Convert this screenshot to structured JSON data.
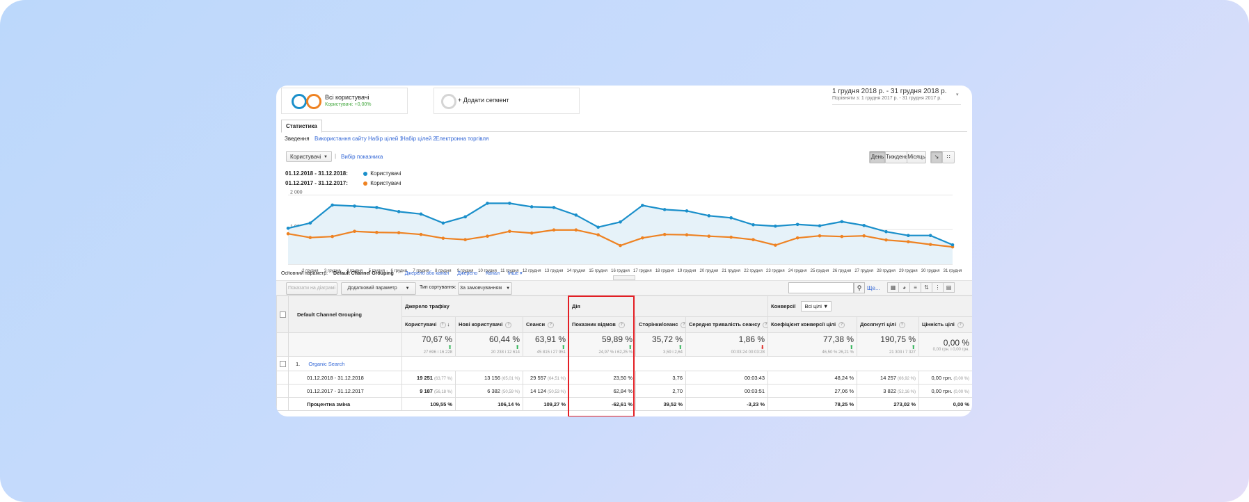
{
  "segments": {
    "all_users": {
      "title": "Всі користувачі",
      "subtitle": "Користувачі: +0,00%"
    },
    "add_segment": "+ Додати сегмент"
  },
  "date_range": {
    "current": "1 грудня 2018 р. - 31 грудня 2018 р.",
    "compare": "Порівняти з: 1 грудня 2017 р. - 31 грудня 2017 р."
  },
  "tab": "Статистика",
  "subnav": [
    "Зведення",
    "Використання сайту",
    "Набір цілей 1",
    "Набір цілей 2",
    "Електронна торгівля"
  ],
  "metric_selector": {
    "value": "Користувачі",
    "select_metric": "Вибір показника"
  },
  "period_buttons": [
    "День",
    "Тиждень",
    "Місяць"
  ],
  "colors": {
    "series_2018": "#1a8fca",
    "series_2017": "#ee8222",
    "link": "#3367d6",
    "highlight": "#e31e24"
  },
  "chart_data": {
    "type": "line",
    "x": [
      "...",
      "2 грудня",
      "3 грудня",
      "4 грудня",
      "5 грудня",
      "6 грудня",
      "7 грудня",
      "8 грудня",
      "9 грудня",
      "10 грудня",
      "11 грудня",
      "12 грудня",
      "13 грудня",
      "14 грудня",
      "15 грудня",
      "16 грудня",
      "17 грудня",
      "18 грудня",
      "19 грудня",
      "20 грудня",
      "21 грудня",
      "22 грудня",
      "23 грудня",
      "24 грудня",
      "25 грудня",
      "26 грудня",
      "27 грудня",
      "28 грудня",
      "29 грудня",
      "30 грудня",
      "31 грудня"
    ],
    "series": [
      {
        "legend_date": "01.12.2018 - 31.12.2018:",
        "name": "Користувачі",
        "values": [
          1040,
          1190,
          1710,
          1680,
          1640,
          1520,
          1450,
          1190,
          1370,
          1760,
          1760,
          1660,
          1640,
          1420,
          1070,
          1220,
          1700,
          1580,
          1540,
          1400,
          1340,
          1140,
          1100,
          1150,
          1110,
          1230,
          1120,
          940,
          830,
          830,
          560
        ]
      },
      {
        "legend_date": "01.12.2017 - 31.12.2017:",
        "name": "Користувачі",
        "values": [
          880,
          770,
          800,
          950,
          920,
          910,
          860,
          750,
          710,
          810,
          950,
          900,
          990,
          990,
          850,
          540,
          760,
          860,
          850,
          810,
          780,
          710,
          550,
          760,
          820,
          800,
          820,
          700,
          650,
          570,
          500
        ]
      }
    ],
    "y_ticks": [
      "2 000",
      "1 000"
    ],
    "ylim": [
      0,
      2150
    ]
  },
  "dimension_bar": {
    "label": "Основний параметр:",
    "current": "Default Channel Grouping",
    "options": [
      "Джерело або канал",
      "Джерело",
      "Канал",
      "Інше"
    ]
  },
  "toolbar": {
    "plot_rows": "Показати на діаграмі",
    "secondary_dim": "Додатковий параметр",
    "sort_type_label": "Тип сортування:",
    "sort_value": "За замовчуванням",
    "more": "Ще..."
  },
  "table": {
    "group_headers": {
      "acquisition": "Джерело трафіку",
      "behavior": "Дія",
      "conversions": "Конверсії",
      "goal_select": "Всі цілі"
    },
    "dim_header": "Default Channel Grouping",
    "columns": [
      "Користувачі",
      "Нові користувачі",
      "Сеанси",
      "Показник відмов",
      "Сторінки/сеанс",
      "Середня тривалість сеансу",
      "Коефіцієнт конверсії цілі",
      "Досягнуті цілі",
      "Цінність цілі"
    ],
    "totals": [
      {
        "big": "70,67 %",
        "dir": "up",
        "small": "27 696 і 16 228"
      },
      {
        "big": "60,44 %",
        "dir": "up",
        "small": "20 238 і 12 614"
      },
      {
        "big": "63,91 %",
        "dir": "up",
        "small": "45 815 і 27 951"
      },
      {
        "big": "59,89 %",
        "dir": "up",
        "small": "24,97 % і 62,25 %"
      },
      {
        "big": "35,72 %",
        "dir": "up",
        "small": "3,59 і 2,64"
      },
      {
        "big": "1,86 %",
        "dir": "down",
        "small": "00:03:24 00:03:28"
      },
      {
        "big": "77,38 %",
        "dir": "up",
        "small": "46,50 % 26,21 %"
      },
      {
        "big": "190,75 %",
        "dir": "up",
        "small": "21 303 і 7 327"
      },
      {
        "big": "0,00 %",
        "dir": "",
        "small": "0,00 грн. і 0,00 грн."
      }
    ],
    "row_index": "1.",
    "row_name": "Organic Search",
    "rows": [
      {
        "label": "01.12.2018 - 31.12.2018",
        "cells": [
          [
            "19 251",
            "(63,77 %)"
          ],
          [
            "13 156",
            "(65,01 %)"
          ],
          [
            "29 557",
            "(64,51 %)"
          ],
          [
            "23,50 %",
            ""
          ],
          [
            "3,76",
            ""
          ],
          [
            "00:03:43",
            ""
          ],
          [
            "48,24 %",
            ""
          ],
          [
            "14 257",
            "(66,92 %)"
          ],
          [
            "0,00 грн.",
            "(0,00 %)"
          ]
        ]
      },
      {
        "label": "01.12.2017 - 31.12.2017",
        "cells": [
          [
            "9 187",
            "(56,18 %)"
          ],
          [
            "6 382",
            "(50,59 %)"
          ],
          [
            "14 124",
            "(50,53 %)"
          ],
          [
            "62,84 %",
            ""
          ],
          [
            "2,70",
            ""
          ],
          [
            "00:03:51",
            ""
          ],
          [
            "27,06 %",
            ""
          ],
          [
            "3 822",
            "(52,16 %)"
          ],
          [
            "0,00 грн.",
            "(0,00 %)"
          ]
        ]
      },
      {
        "label": "Процентна зміна",
        "cells": [
          [
            "109,55 %",
            ""
          ],
          [
            "106,14 %",
            ""
          ],
          [
            "109,27 %",
            ""
          ],
          [
            "-62,61 %",
            ""
          ],
          [
            "39,52 %",
            ""
          ],
          [
            "-3,23 %",
            ""
          ],
          [
            "78,25 %",
            ""
          ],
          [
            "273,02 %",
            ""
          ],
          [
            "0,00 %",
            ""
          ]
        ]
      }
    ]
  }
}
